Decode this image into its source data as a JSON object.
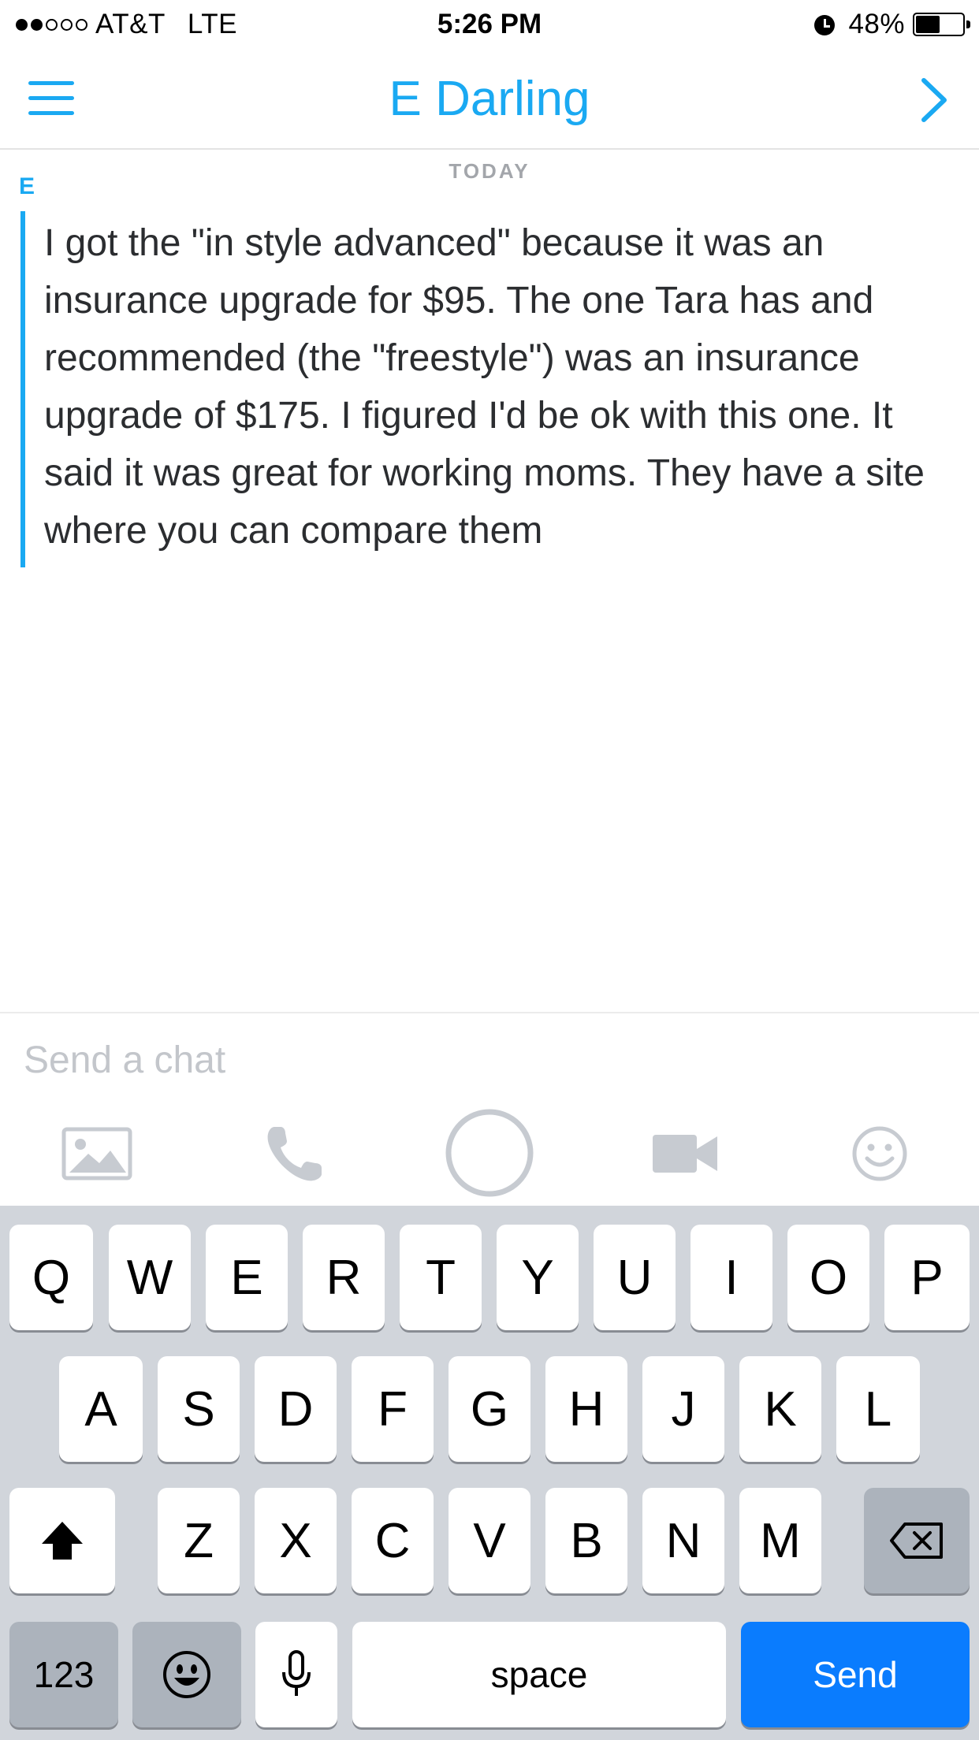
{
  "status_bar": {
    "carrier": "AT&T",
    "network": "LTE",
    "time": "5:26 PM",
    "battery_percent": "48%",
    "battery_level": 0.48,
    "signal_bars_filled": 2,
    "signal_bars_total": 5
  },
  "header": {
    "title": "E Darling"
  },
  "conversation": {
    "date_label": "TODAY",
    "sender_initial": "E",
    "message": "I got the \"in style advanced\" because it was an insurance upgrade for $95. The one Tara has and recommended (the \"freestyle\") was an insurance upgrade of $175. I figured I'd be ok with this one. It said it was great for working moms. They have a site where you can compare them"
  },
  "composer": {
    "placeholder": "Send a chat",
    "value": ""
  },
  "toolbar": {
    "icons": [
      "image-icon",
      "phone-icon",
      "capture-circle-icon",
      "video-icon",
      "smiley-icon"
    ]
  },
  "keyboard": {
    "row1": [
      "Q",
      "W",
      "E",
      "R",
      "T",
      "Y",
      "U",
      "I",
      "O",
      "P"
    ],
    "row2": [
      "A",
      "S",
      "D",
      "F",
      "G",
      "H",
      "J",
      "K",
      "L"
    ],
    "row3": [
      "Z",
      "X",
      "C",
      "V",
      "B",
      "N",
      "M"
    ],
    "numbers_label": "123",
    "space_label": "space",
    "send_label": "Send"
  },
  "colors": {
    "accent": "#1aa9f2",
    "send_key": "#0a7cfe",
    "keyboard_bg": "#d1d5db"
  }
}
